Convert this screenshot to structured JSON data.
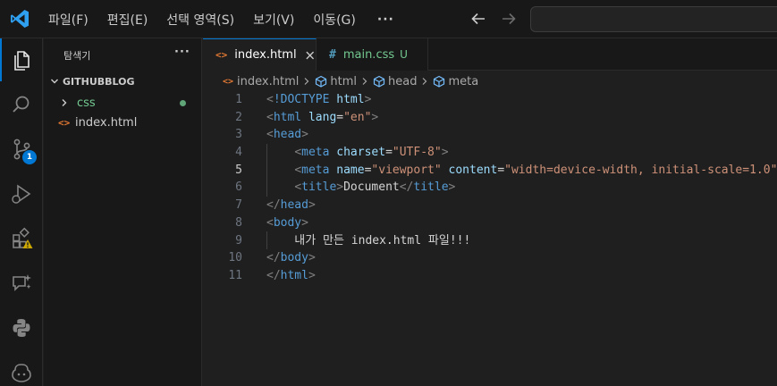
{
  "menu": [
    "파일(F)",
    "편집(E)",
    "선택 영역(S)",
    "보기(V)",
    "이동(G)"
  ],
  "menu_more": "···",
  "activity": {
    "source_control_badge": "1"
  },
  "sidebar": {
    "title": "탐색기",
    "more": "···",
    "section": "GITHUBBLOG",
    "folder": "css",
    "file": "index.html",
    "file_icon": "<>"
  },
  "tabs": {
    "active": {
      "icon": "<>",
      "label": "index.html"
    },
    "second": {
      "icon": "#",
      "label": "main.css",
      "status": "U"
    }
  },
  "breadcrumb": {
    "file": "index.html",
    "items": [
      "html",
      "head",
      "meta"
    ]
  },
  "editor": {
    "line_numbers": [
      "1",
      "2",
      "3",
      "4",
      "5",
      "6",
      "7",
      "8",
      "9",
      "10",
      "11"
    ],
    "current_line": 5,
    "lines": [
      [
        [
          "t",
          "<"
        ],
        [
          "tag",
          "!DOCTYPE"
        ],
        [
          "txt",
          " "
        ],
        [
          "attr",
          "html"
        ],
        [
          "t",
          ">"
        ]
      ],
      [
        [
          "t",
          "<"
        ],
        [
          "tag",
          "html"
        ],
        [
          "txt",
          " "
        ],
        [
          "attr",
          "lang"
        ],
        [
          "txt",
          "="
        ],
        [
          "str",
          "\"en\""
        ],
        [
          "t",
          ">"
        ]
      ],
      [
        [
          "t",
          "<"
        ],
        [
          "tag",
          "head"
        ],
        [
          "t",
          ">"
        ]
      ],
      [
        [
          "txt",
          "    "
        ],
        [
          "t",
          "<"
        ],
        [
          "tag",
          "meta"
        ],
        [
          "txt",
          " "
        ],
        [
          "attr",
          "charset"
        ],
        [
          "txt",
          "="
        ],
        [
          "str",
          "\"UTF-8\""
        ],
        [
          "t",
          ">"
        ]
      ],
      [
        [
          "txt",
          "    "
        ],
        [
          "t",
          "<"
        ],
        [
          "tag",
          "meta"
        ],
        [
          "txt",
          " "
        ],
        [
          "attr",
          "name"
        ],
        [
          "txt",
          "="
        ],
        [
          "str",
          "\"viewport\""
        ],
        [
          "txt",
          " "
        ],
        [
          "attr",
          "content"
        ],
        [
          "txt",
          "="
        ],
        [
          "str",
          "\"width=device-width, initial-scale=1.0\""
        ],
        [
          "t",
          ">"
        ]
      ],
      [
        [
          "txt",
          "    "
        ],
        [
          "t",
          "<"
        ],
        [
          "tag",
          "title"
        ],
        [
          "t",
          ">"
        ],
        [
          "txt",
          "Document"
        ],
        [
          "t",
          "</"
        ],
        [
          "tag",
          "title"
        ],
        [
          "t",
          ">"
        ]
      ],
      [
        [
          "t",
          "</"
        ],
        [
          "tag",
          "head"
        ],
        [
          "t",
          ">"
        ]
      ],
      [
        [
          "t",
          "<"
        ],
        [
          "tag",
          "body"
        ],
        [
          "t",
          ">"
        ]
      ],
      [
        [
          "txt",
          "    내가 만든 index.html 파일!!!"
        ]
      ],
      [
        [
          "t",
          "</"
        ],
        [
          "tag",
          "body"
        ],
        [
          "t",
          ">"
        ]
      ],
      [
        [
          "t",
          "</"
        ],
        [
          "tag",
          "html"
        ],
        [
          "t",
          ">"
        ]
      ]
    ]
  },
  "colors": {
    "accent": "#0078d4",
    "untracked": "#73c991",
    "html_icon": "#e37933",
    "css_icon": "#519aba"
  }
}
